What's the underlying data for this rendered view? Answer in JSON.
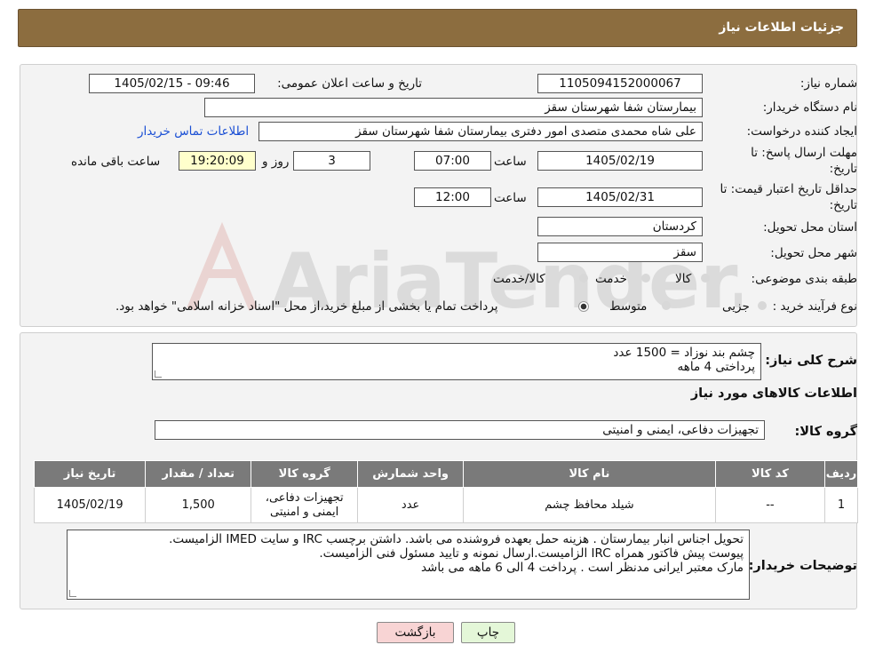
{
  "header": {
    "title": "جزئیات اطلاعات نیاز"
  },
  "fields": {
    "need_number_label": "شماره نیاز:",
    "need_number": "1105094152000067",
    "announce_label": "تاریخ و ساعت اعلان عمومی:",
    "announce_value": "1405/02/15 - 09:46",
    "buyer_org_label": "نام دستگاه خریدار:",
    "buyer_org": "بیمارستان شفا شهرستان سقز",
    "creator_label": "ایجاد کننده درخواست:",
    "creator": "علی شاه محمدی متصدی امور دفتری بیمارستان شفا شهرستان سقز",
    "contact_link": "اطلاعات تماس خریدار",
    "deadline_label_1": "مهلت ارسال پاسخ: تا",
    "deadline_label_2": "تاریخ:",
    "deadline_date": "1405/02/19",
    "hour_word": "ساعت",
    "deadline_time": "07:00",
    "days_value": "3",
    "days_word": "روز و",
    "remaining_time": "19:20:09",
    "remaining_word": "ساعت باقی مانده",
    "validity_label_1": "حداقل تاریخ اعتبار قیمت: تا",
    "validity_label_2": "تاریخ:",
    "validity_date": "1405/02/31",
    "validity_time": "12:00",
    "province_label": "استان محل تحویل:",
    "province": "کردستان",
    "city_label": "شهر محل تحویل:",
    "city": "سقز",
    "category_label": "طبقه بندی موضوعی:",
    "category_options": [
      "کالا",
      "خدمت",
      "کالا/خدمت"
    ],
    "process_label": "نوع فرآیند خرید :",
    "process_options": [
      "جزیی",
      "متوسط"
    ],
    "process_note": "پرداخت تمام یا بخشی از مبلغ خرید،از محل \"اسناد خزانه اسلامی\" خواهد بود."
  },
  "description": {
    "label": "شرح کلی نیاز:",
    "line1": "چشم بند نوزاد = 1500 عدد",
    "line2": "پرداختی 4 ماهه"
  },
  "goods_section_title": "اطلاعات کالاهای مورد نیاز",
  "goods_group": {
    "label": "گروه کالا:",
    "value": "تجهیزات دفاعی، ایمنی و امنیتی"
  },
  "table": {
    "headers": [
      "ردیف",
      "کد کالا",
      "نام کالا",
      "واحد شمارش",
      "گروه کالا",
      "تعداد / مقدار",
      "تاریخ نیاز"
    ],
    "rows": [
      [
        "1",
        "--",
        "شیلد محافظ چشم",
        "عدد",
        "تجهیزات دفاعی، ایمنی و امنیتی",
        "1,500",
        "1405/02/19"
      ]
    ]
  },
  "buyer_notes": {
    "label": "توضیحات خریدار:",
    "line1": "تحویل اجناس  انبار بیمارستان . هزینه حمل بعهده فروشنده می باشد.  داشتن برچسب IRC  و سایت  IMED  الزامیست.",
    "line2": "پیوست پیش فاکتور همراه IRC  الزامیست.ارسال نمونه و تایید مسئول فنی الزامیست.",
    "line3": "مارک معتبر ایرانی مدنظر است . پرداخت 4 الی 6 ماهه می باشد"
  },
  "buttons": {
    "print": "چاپ",
    "back": "بازگشت"
  },
  "watermark": {
    "text": "AriaTender.neT"
  },
  "colors": {
    "header_bg": "#8c6d3f",
    "table_header_bg": "#7a7a7a",
    "link": "#1a4fd4",
    "print_bg": "#e4f7d8",
    "back_bg": "#f8d4d4"
  }
}
